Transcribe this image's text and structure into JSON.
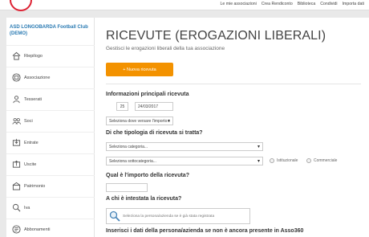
{
  "topnav": [
    "Le mie associazioni",
    "Crea Rendiconto",
    "Biblioteca",
    "Condividi",
    "Importa dati"
  ],
  "sidebar": {
    "club_name": "ASD LONGOBARDA Football Club (DEMO)",
    "items": [
      {
        "label": "Riepilogo",
        "icon": "home-icon"
      },
      {
        "label": "Associazione",
        "icon": "building-icon"
      },
      {
        "label": "Tesserati",
        "icon": "members-icon"
      },
      {
        "label": "Soci",
        "icon": "partners-icon"
      },
      {
        "label": "Entrate",
        "icon": "income-icon"
      },
      {
        "label": "Uscite",
        "icon": "expenses-icon"
      },
      {
        "label": "Patrimonio",
        "icon": "assets-icon"
      },
      {
        "label": "Iva",
        "icon": "tax-icon"
      },
      {
        "label": "Abbonamenti",
        "icon": "subscription-icon"
      }
    ]
  },
  "main": {
    "title": "RICEVUTE (EROGAZIONI LIBERALI)",
    "subtitle": "Gestisci le erogazioni liberali della tua associazione",
    "new_button": "+ Nuova ricevuta",
    "section_info": "Informazioni principali ricevuta",
    "receipt_number": "25",
    "receipt_date": "24/03/2017",
    "deposit_select": "Seleziona dove versare l'importo...",
    "section_type": "Di che tipologia di ricevuta si tratta?",
    "category_select": "Seleziona categoria...",
    "subcategory_select": "Seleziona sottocategoria...",
    "radio_institutional": "Istituzionale",
    "radio_commercial": "Commerciale",
    "section_amount": "Qual è l'importo della ricevuta?",
    "amount_value": "",
    "section_holder": "A chi è intestata la ricevuta?",
    "holder_placeholder": "Seleziona la persona/azienda se è già stata registrata",
    "section_new_person": "Inserisci i dati della persona/azienda se non è ancora presente in Asso360"
  },
  "colors": {
    "accent": "#f39200",
    "club_name": "#2b7bb3"
  }
}
